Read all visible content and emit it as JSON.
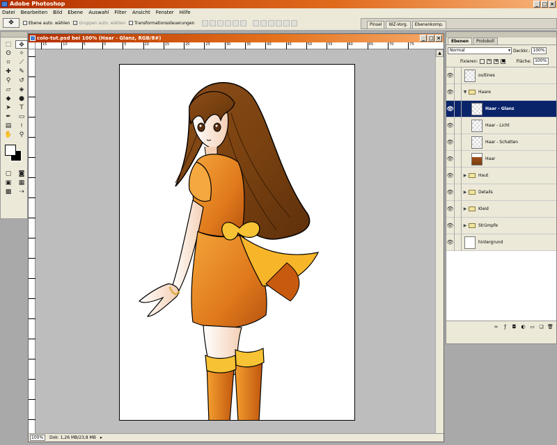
{
  "app": {
    "title": "Adobe Photoshop"
  },
  "menu": [
    "Datei",
    "Bearbeiten",
    "Bild",
    "Ebene",
    "Auswahl",
    "Filter",
    "Ansicht",
    "Fenster",
    "Hilfe"
  ],
  "options": {
    "auto_select_layer": "Ebene auto. wählen",
    "auto_select_groups": "Gruppen auto. wählen",
    "transform_controls": "Transformationssteuerungen"
  },
  "palette_well": [
    "Pinsel",
    "WZ-Vorg.",
    "Ebenenkomp."
  ],
  "document": {
    "title": "colo-tut.psd bei 100% (Haar - Glanz, RGB/8#)",
    "zoom": "100%",
    "doc_size": "Dok: 1,26 MB/23,8 MB",
    "ruler_ticks": [
      "15",
      "10",
      "5",
      "0",
      "5",
      "10",
      "15",
      "20",
      "25",
      "30",
      "35",
      "40",
      "45",
      "50",
      "55",
      "60",
      "65",
      "70",
      "75"
    ]
  },
  "layers_panel": {
    "tabs": [
      "Ebenen",
      "Protokoll"
    ],
    "blend_mode": "Normal",
    "opacity_label": "Deckkr.:",
    "opacity_value": "100%",
    "lock_label": "Fixieren:",
    "fill_label": "Fläche:",
    "fill_value": "100%",
    "items": [
      {
        "name": "outlines",
        "type": "layer",
        "depth": 0
      },
      {
        "name": "Haare",
        "type": "group-open",
        "depth": 0
      },
      {
        "name": "Haar - Glanz",
        "type": "layer",
        "depth": 1,
        "active": true
      },
      {
        "name": "Haar - Licht",
        "type": "layer",
        "depth": 1
      },
      {
        "name": "Haar - Schatten",
        "type": "layer",
        "depth": 1
      },
      {
        "name": "Haar",
        "type": "layer",
        "depth": 1
      },
      {
        "name": "Haut",
        "type": "group",
        "depth": 0
      },
      {
        "name": "Details",
        "type": "group",
        "depth": 0
      },
      {
        "name": "Kleid",
        "type": "group",
        "depth": 0
      },
      {
        "name": "Strümpfe",
        "type": "group",
        "depth": 0
      },
      {
        "name": "hintergrund",
        "type": "layer",
        "depth": 0
      }
    ]
  },
  "colors": {
    "foreground": "#ffffff",
    "background": "#000000",
    "title_orange": "#e06a1c",
    "layer_selected": "#0a246a"
  }
}
